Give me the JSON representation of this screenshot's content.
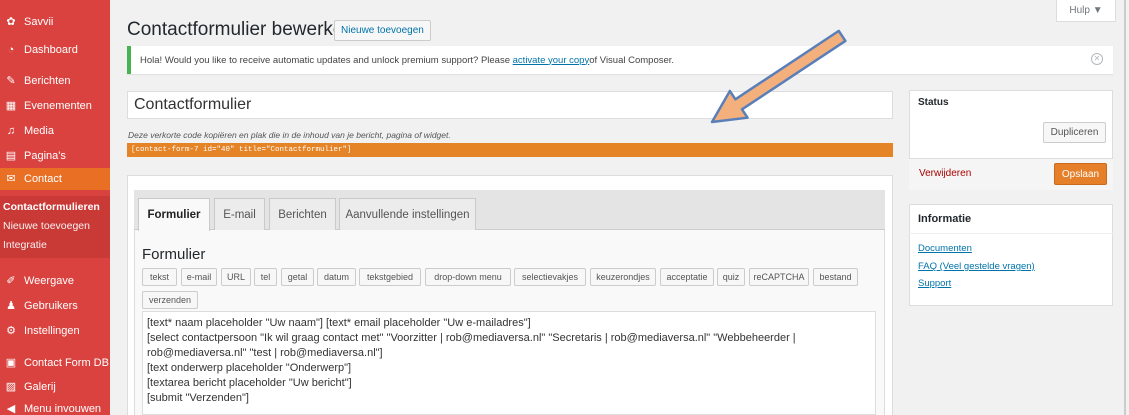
{
  "sidebar": {
    "items": [
      {
        "label": "Savvii",
        "icon": "gear-icon",
        "glyph": "✿"
      },
      {
        "label": "Dashboard",
        "icon": "dashboard-icon",
        "glyph": "◔"
      },
      {
        "label": "Berichten",
        "icon": "pin-icon",
        "glyph": "✎"
      },
      {
        "label": "Evenementen",
        "icon": "calendar-icon",
        "glyph": "▦"
      },
      {
        "label": "Media",
        "icon": "media-icon",
        "glyph": "♫"
      },
      {
        "label": "Pagina's",
        "icon": "page-icon",
        "glyph": "▤"
      },
      {
        "label": "Contact",
        "icon": "mail-icon",
        "glyph": "✉"
      },
      {
        "label": "Weergave",
        "icon": "brush-icon",
        "glyph": "✐"
      },
      {
        "label": "Gebruikers",
        "icon": "users-icon",
        "glyph": "♟"
      },
      {
        "label": "Instellingen",
        "icon": "settings-icon",
        "glyph": "⚙"
      },
      {
        "label": "Contact Form DB",
        "icon": "database-icon",
        "glyph": "▣"
      },
      {
        "label": "Galerij",
        "icon": "gallery-icon",
        "glyph": "▨"
      },
      {
        "label": "Menu invouwen",
        "icon": "collapse-icon",
        "glyph": "◀"
      }
    ],
    "submenu": [
      {
        "label": "Contactformulieren"
      },
      {
        "label": "Nieuwe toevoegen"
      },
      {
        "label": "Integratie"
      }
    ]
  },
  "header": {
    "title": "Contactformulier bewerken",
    "new_button": "Nieuwe toevoegen",
    "help": "Hulp ▼"
  },
  "notice": {
    "text_before": "Hola! Would you like to receive automatic updates and unlock premium support? Please ",
    "link": "activate your copy",
    "text_after": " of Visual Composer.",
    "dismiss": "✕"
  },
  "form": {
    "title": "Contactformulier",
    "shortcode_hint": "Deze verkorte code kopiëren en plak die in de inhoud van je bericht, pagina of widget.",
    "shortcode": "[contact-form-7 id=\"40\" title=\"Contactformulier\"]"
  },
  "tabs": [
    {
      "label": "Formulier"
    },
    {
      "label": "E-mail"
    },
    {
      "label": "Berichten"
    },
    {
      "label": "Aanvullende instellingen"
    }
  ],
  "editor": {
    "heading": "Formulier",
    "tags": [
      "tekst",
      "e-mail",
      "URL",
      "tel",
      "getal",
      "datum",
      "tekstgebied",
      "drop-down menu",
      "selectievakjes",
      "keuzerondjes",
      "acceptatie",
      "quiz",
      "reCAPTCHA",
      "bestand",
      "verzenden"
    ],
    "code_lines": [
      "[text* naam placeholder \"Uw naam\"] [text* email placeholder \"Uw e-mailadres\"]",
      "[select contactpersoon \"Ik wil graag contact met\" \"Voorzitter | rob@mediaversa.nl\" \"Secretaris | rob@mediaversa.nl\" \"Webbeheerder |",
      "rob@mediaversa.nl\" \"test | rob@mediaversa.nl\"]",
      "[text onderwerp placeholder \"Onderwerp\"]",
      "[textarea bericht placeholder \"Uw bericht\"]",
      "[submit \"Verzenden\"]"
    ]
  },
  "status": {
    "title": "Status",
    "duplicate": "Dupliceren",
    "delete": "Verwijderen",
    "save": "Opslaan"
  },
  "info": {
    "title": "Informatie",
    "links": [
      "Documenten",
      "FAQ (Veel gestelde vragen)",
      "Support"
    ]
  }
}
